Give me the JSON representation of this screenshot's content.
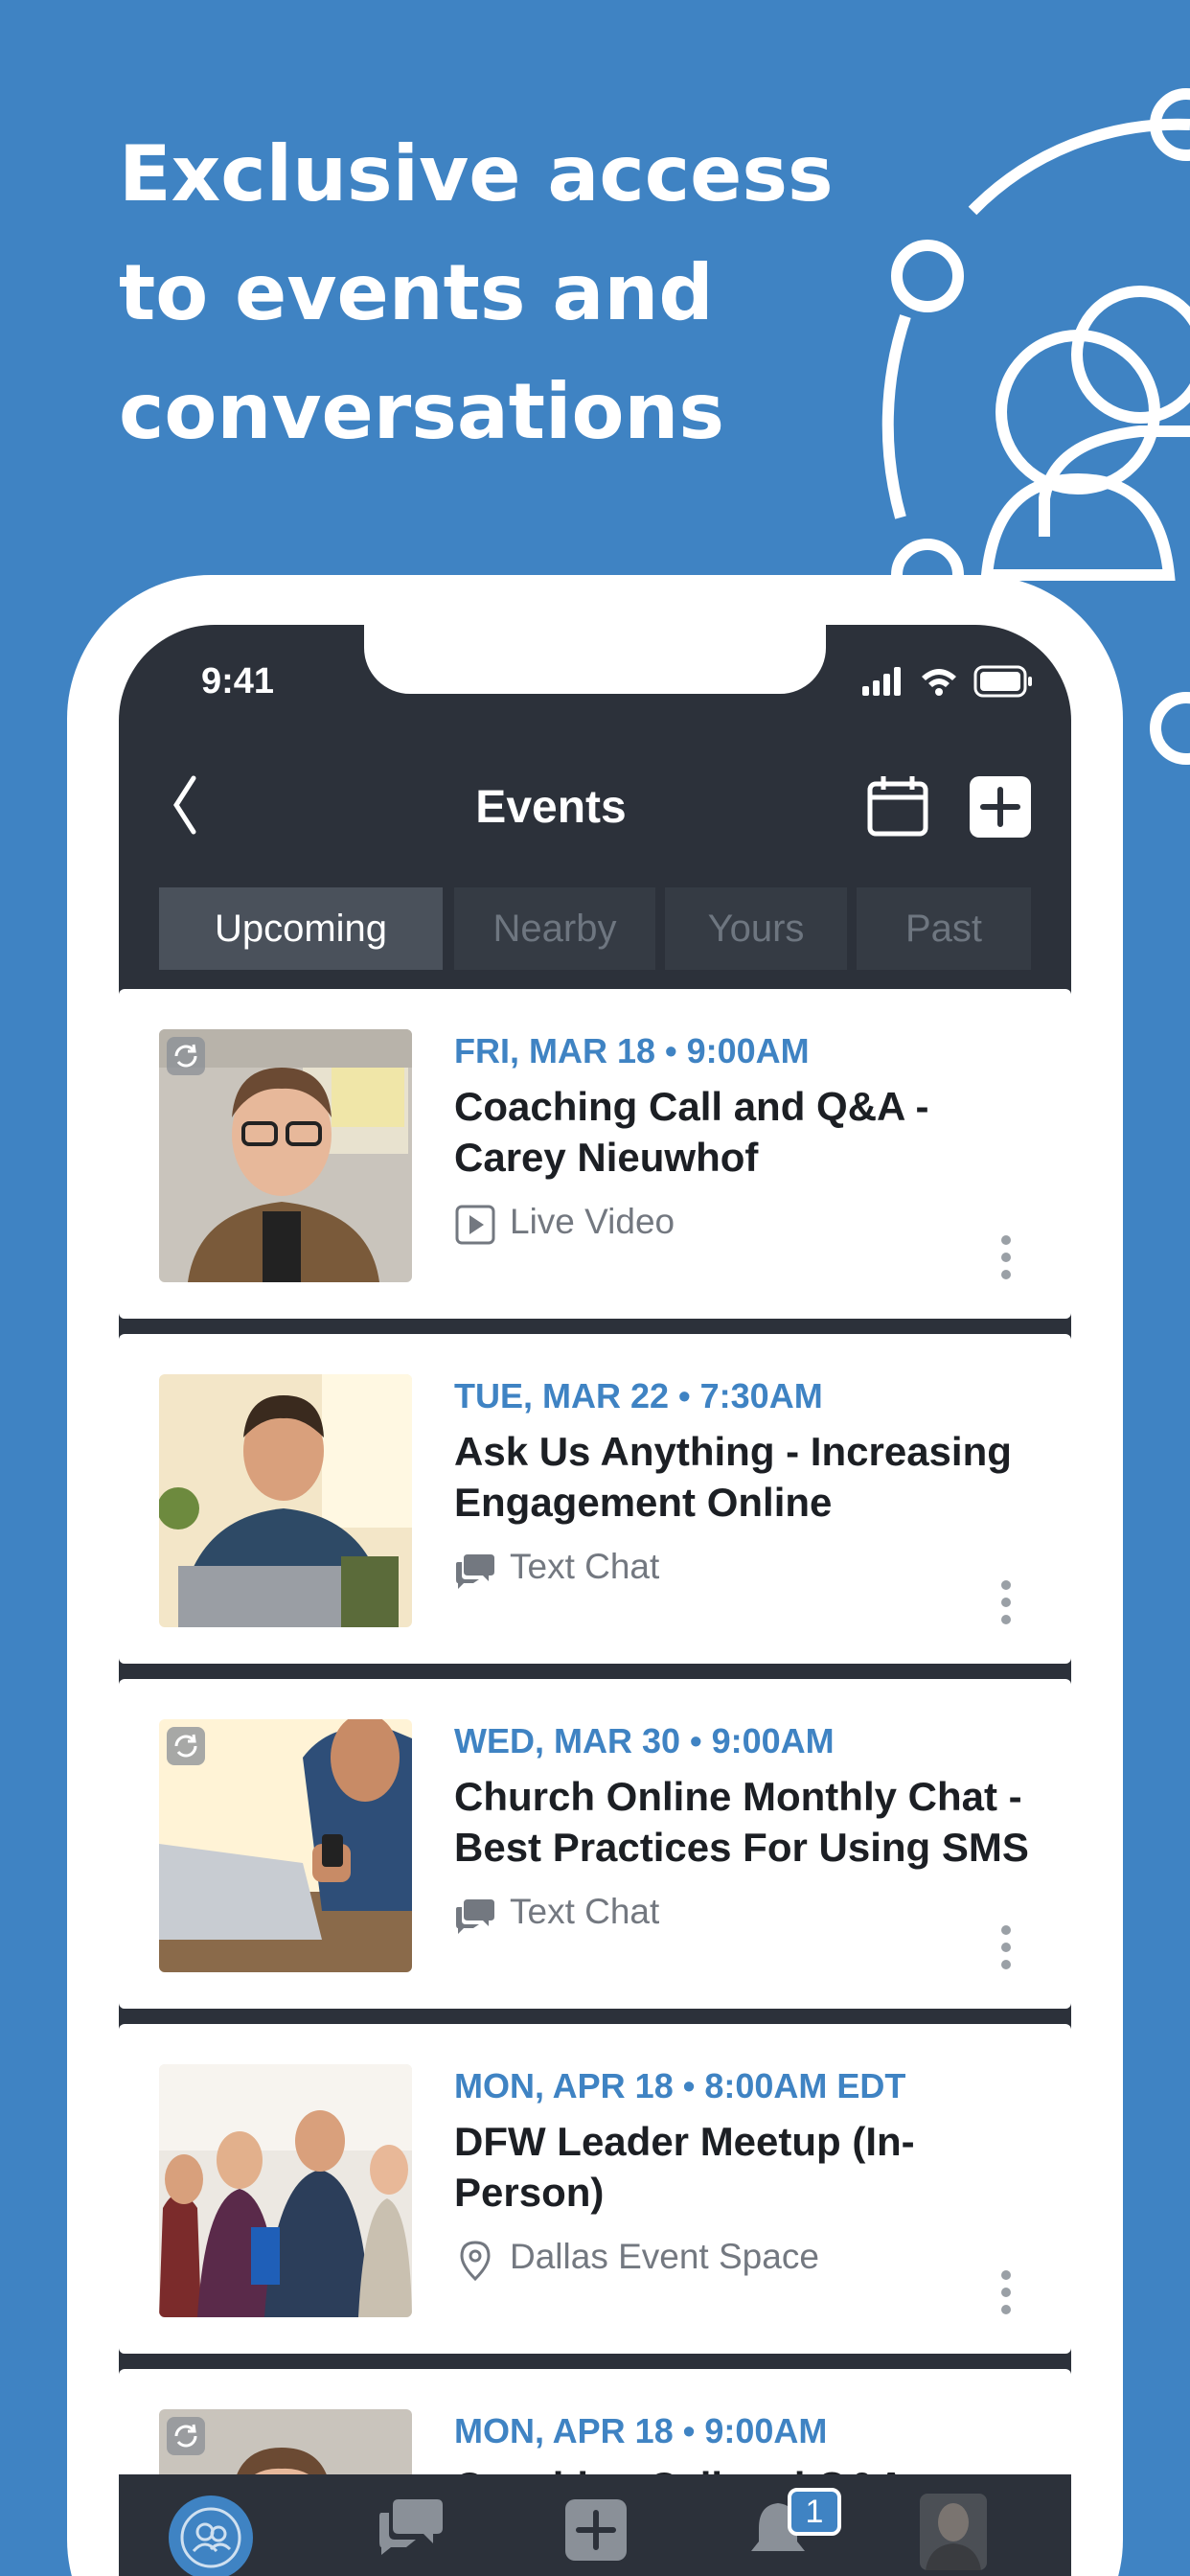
{
  "headline": [
    "Exclusive access",
    "to events and",
    "conversations"
  ],
  "status_bar": {
    "time": "9:41"
  },
  "nav": {
    "title": "Events"
  },
  "tabs": [
    {
      "label": "Upcoming",
      "active": true
    },
    {
      "label": "Nearby",
      "active": false
    },
    {
      "label": "Yours",
      "active": false
    },
    {
      "label": "Past",
      "active": false
    }
  ],
  "events": [
    {
      "date": "FRI, MAR 18 • 9:00AM",
      "title": "Coaching Call and Q&A - Carey Nieuwhof",
      "type_icon": "play-icon",
      "type": "Live Video",
      "recurring": true
    },
    {
      "date": "TUE, MAR 22 • 7:30AM",
      "title": "Ask Us Anything - Increasing Engagement Online",
      "type_icon": "chat-icon",
      "type": "Text Chat",
      "recurring": false
    },
    {
      "date": "WED, MAR 30 • 9:00AM",
      "title": "Church Online Monthly Chat - Best Practices For Using SMS",
      "type_icon": "chat-icon",
      "type": "Text Chat",
      "recurring": true
    },
    {
      "date": "MON, APR 18 • 8:00AM EDT",
      "title": "DFW Leader Meetup (In-Person)",
      "type_icon": "location-pin-icon",
      "type": "Dallas Event Space",
      "recurring": false
    },
    {
      "date": "MON, APR 18 • 9:00AM",
      "title": "Coaching Call and Q&A",
      "type_icon": "",
      "type": "",
      "recurring": true
    }
  ],
  "bottom_nav": {
    "items": [
      "community-icon",
      "chat-icon",
      "add-icon",
      "bell-icon",
      "profile-avatar"
    ],
    "notification_count": "1"
  },
  "colors": {
    "brand_blue": "#3f83c3",
    "dark_bg": "#2c313a",
    "date_blue": "#3f83c3"
  }
}
